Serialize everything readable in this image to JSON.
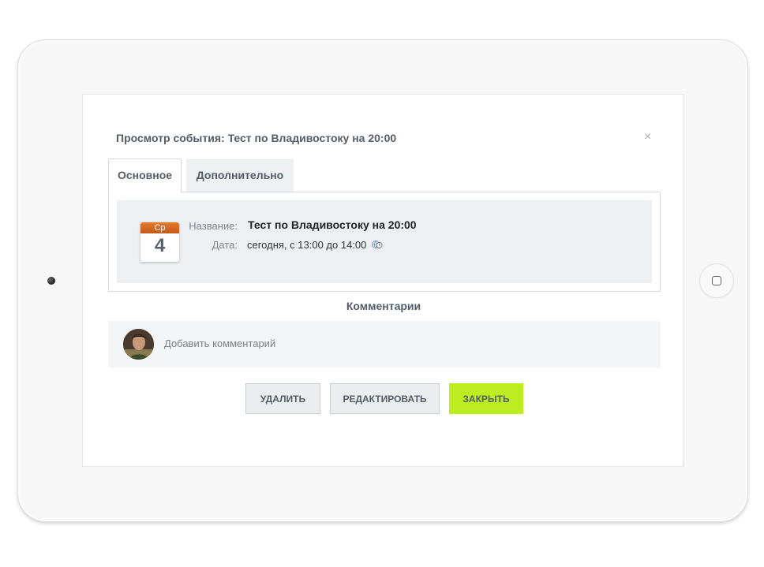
{
  "dialog": {
    "title": "Просмотр события: Тест по Владивостоку на 20:00",
    "close_icon": "×"
  },
  "tabs": [
    {
      "label": "Основное",
      "active": true
    },
    {
      "label": "Дополнительно",
      "active": false
    }
  ],
  "event": {
    "calendar_weekday": "Ср",
    "calendar_day": "4",
    "name_label": "Название:",
    "name_value": "Тест по Владивостоку на 20:00",
    "date_label": "Дата:",
    "date_value": "сегодня, с 13:00 до 14:00",
    "timezone_icon": "globe-clock-icon"
  },
  "comments": {
    "title": "Комментарии",
    "placeholder": "Добавить комментарий"
  },
  "buttons": {
    "delete": "УДАЛИТЬ",
    "edit": "РЕДАКТИРОВАТЬ",
    "close": "ЗАКРЫТЬ"
  },
  "colors": {
    "accent_green": "#bbed21",
    "calendar_orange": "#d7651f",
    "text_dark": "#535c69"
  }
}
